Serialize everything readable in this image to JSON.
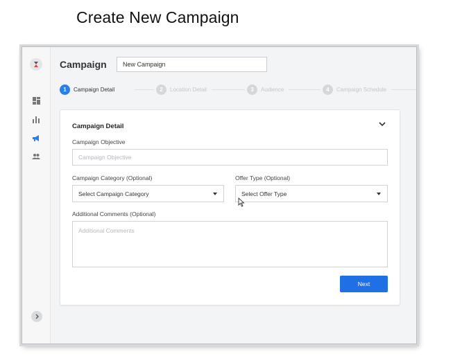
{
  "slide": {
    "title": "Create New Campaign"
  },
  "rail": {
    "icons": [
      "logo-icon",
      "dashboard-icon",
      "bar-chart-icon",
      "megaphone-icon",
      "users-icon"
    ],
    "active_icon": "megaphone-icon",
    "expand_icon": "chevron-right-icon"
  },
  "header": {
    "title": "Campaign",
    "name_value": "New Campaign"
  },
  "stepper": {
    "steps": [
      {
        "number": "1",
        "label": "Campaign Detail",
        "active": true
      },
      {
        "number": "2",
        "label": "Location Detail",
        "active": false
      },
      {
        "number": "3",
        "label": "Audience",
        "active": false
      },
      {
        "number": "4",
        "label": "Campaign Schedule",
        "active": false
      }
    ]
  },
  "form": {
    "title": "Campaign Detail",
    "objective": {
      "label": "Campaign Objective",
      "placeholder": "Campaign Objective"
    },
    "category": {
      "label": "Campaign Category (Optional)",
      "value": "Select Campaign Category"
    },
    "offer": {
      "label": "Offer Type (Optional)",
      "value": "Select Offer Type"
    },
    "comments": {
      "label": "Additional Comments (Optional)",
      "placeholder": "Additional Comments"
    },
    "next_label": "Next"
  },
  "colors": {
    "accent": "#1f6fe5",
    "step_active": "#2b7de9",
    "step_inactive": "#d5d7db"
  }
}
